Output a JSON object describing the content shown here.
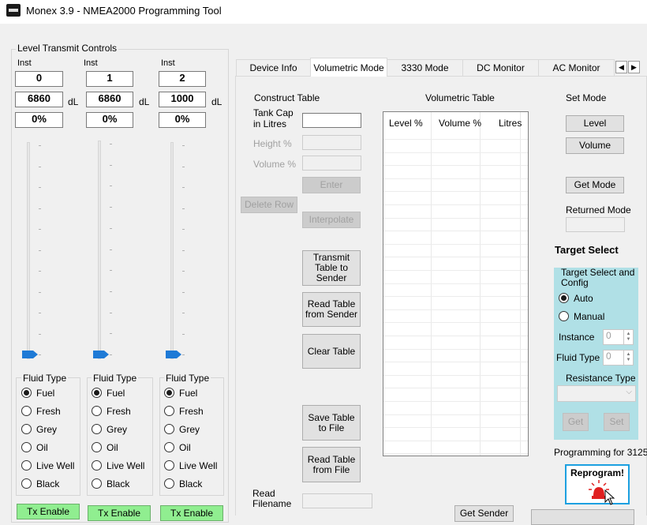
{
  "window": {
    "title": "Monex 3.9 - NMEA2000 Programming Tool"
  },
  "level_transmit": {
    "title": "Level Transmit Controls",
    "channels": [
      {
        "inst_label": "Inst",
        "inst": "0",
        "dl_value": "6860",
        "unit": "dL",
        "percent": "0%",
        "slider_level": 0
      },
      {
        "inst_label": "Inst",
        "inst": "1",
        "dl_value": "6860",
        "unit": "dL",
        "percent": "0%",
        "slider_level": 0
      },
      {
        "inst_label": "Inst",
        "inst": "2",
        "dl_value": "1000",
        "unit": "dL",
        "percent": "0%",
        "slider_level": 0
      }
    ],
    "fluid_type_title": "Fluid Type",
    "fluid_options": [
      "Fuel",
      "Fresh",
      "Grey",
      "Oil",
      "Live Well",
      "Black"
    ],
    "selected_fluid": "Fuel",
    "tx_enable_label": "Tx Enable"
  },
  "tabs": [
    "Device Info",
    "Volumetric Mode",
    "3330 Mode",
    "DC Monitor",
    "AC Monitor"
  ],
  "active_tab": "Volumetric Mode",
  "construct": {
    "title": "Construct Table",
    "tank_cap_label": "Tank Cap in Litres",
    "tank_cap_value": "",
    "height_label": "Height %",
    "volume_label": "Volume %",
    "enter_label": "Enter",
    "delete_row_label": "Delete Row",
    "interpolate_label": "Interpolate",
    "transmit_label": "Transmit Table to Sender",
    "read_sender_label": "Read Table from Sender",
    "clear_label": "Clear Table",
    "save_file_label": "Save Table to File",
    "read_file_label": "Read Table from File",
    "read_filename_label": "Read Filename",
    "read_filename_value": ""
  },
  "volumetric_table": {
    "title": "Volumetric Table",
    "columns": [
      "Level %",
      "Volume %",
      "Litres"
    ],
    "rows": []
  },
  "set_mode": {
    "title": "Set Mode",
    "level_label": "Level",
    "volume_label": "Volume",
    "get_mode_label": "Get Mode",
    "returned_mode_label": "Returned Mode",
    "returned_mode_value": ""
  },
  "target": {
    "title": "Target Select",
    "config_title": "Target Select and Config",
    "auto_label": "Auto",
    "manual_label": "Manual",
    "selected": "Auto",
    "instance_label": "Instance",
    "instance_value": "0",
    "fluid_type_label": "Fluid Type",
    "fluid_type_value": "0",
    "resistance_label": "Resistance Type",
    "resistance_value": "",
    "get_label": "Get",
    "set_label": "Set"
  },
  "programming_label": "Programming for 3125",
  "reprogram_label": "Reprogram!",
  "get_sender_label": "Get Sender",
  "colors": {
    "tx_enable": "#90ee90",
    "target_panel": "#b0e0e6",
    "slider_thumb": "#1e7ad6",
    "reprogram_border": "#1ca0e0",
    "reprogram_light": "#e02020"
  }
}
